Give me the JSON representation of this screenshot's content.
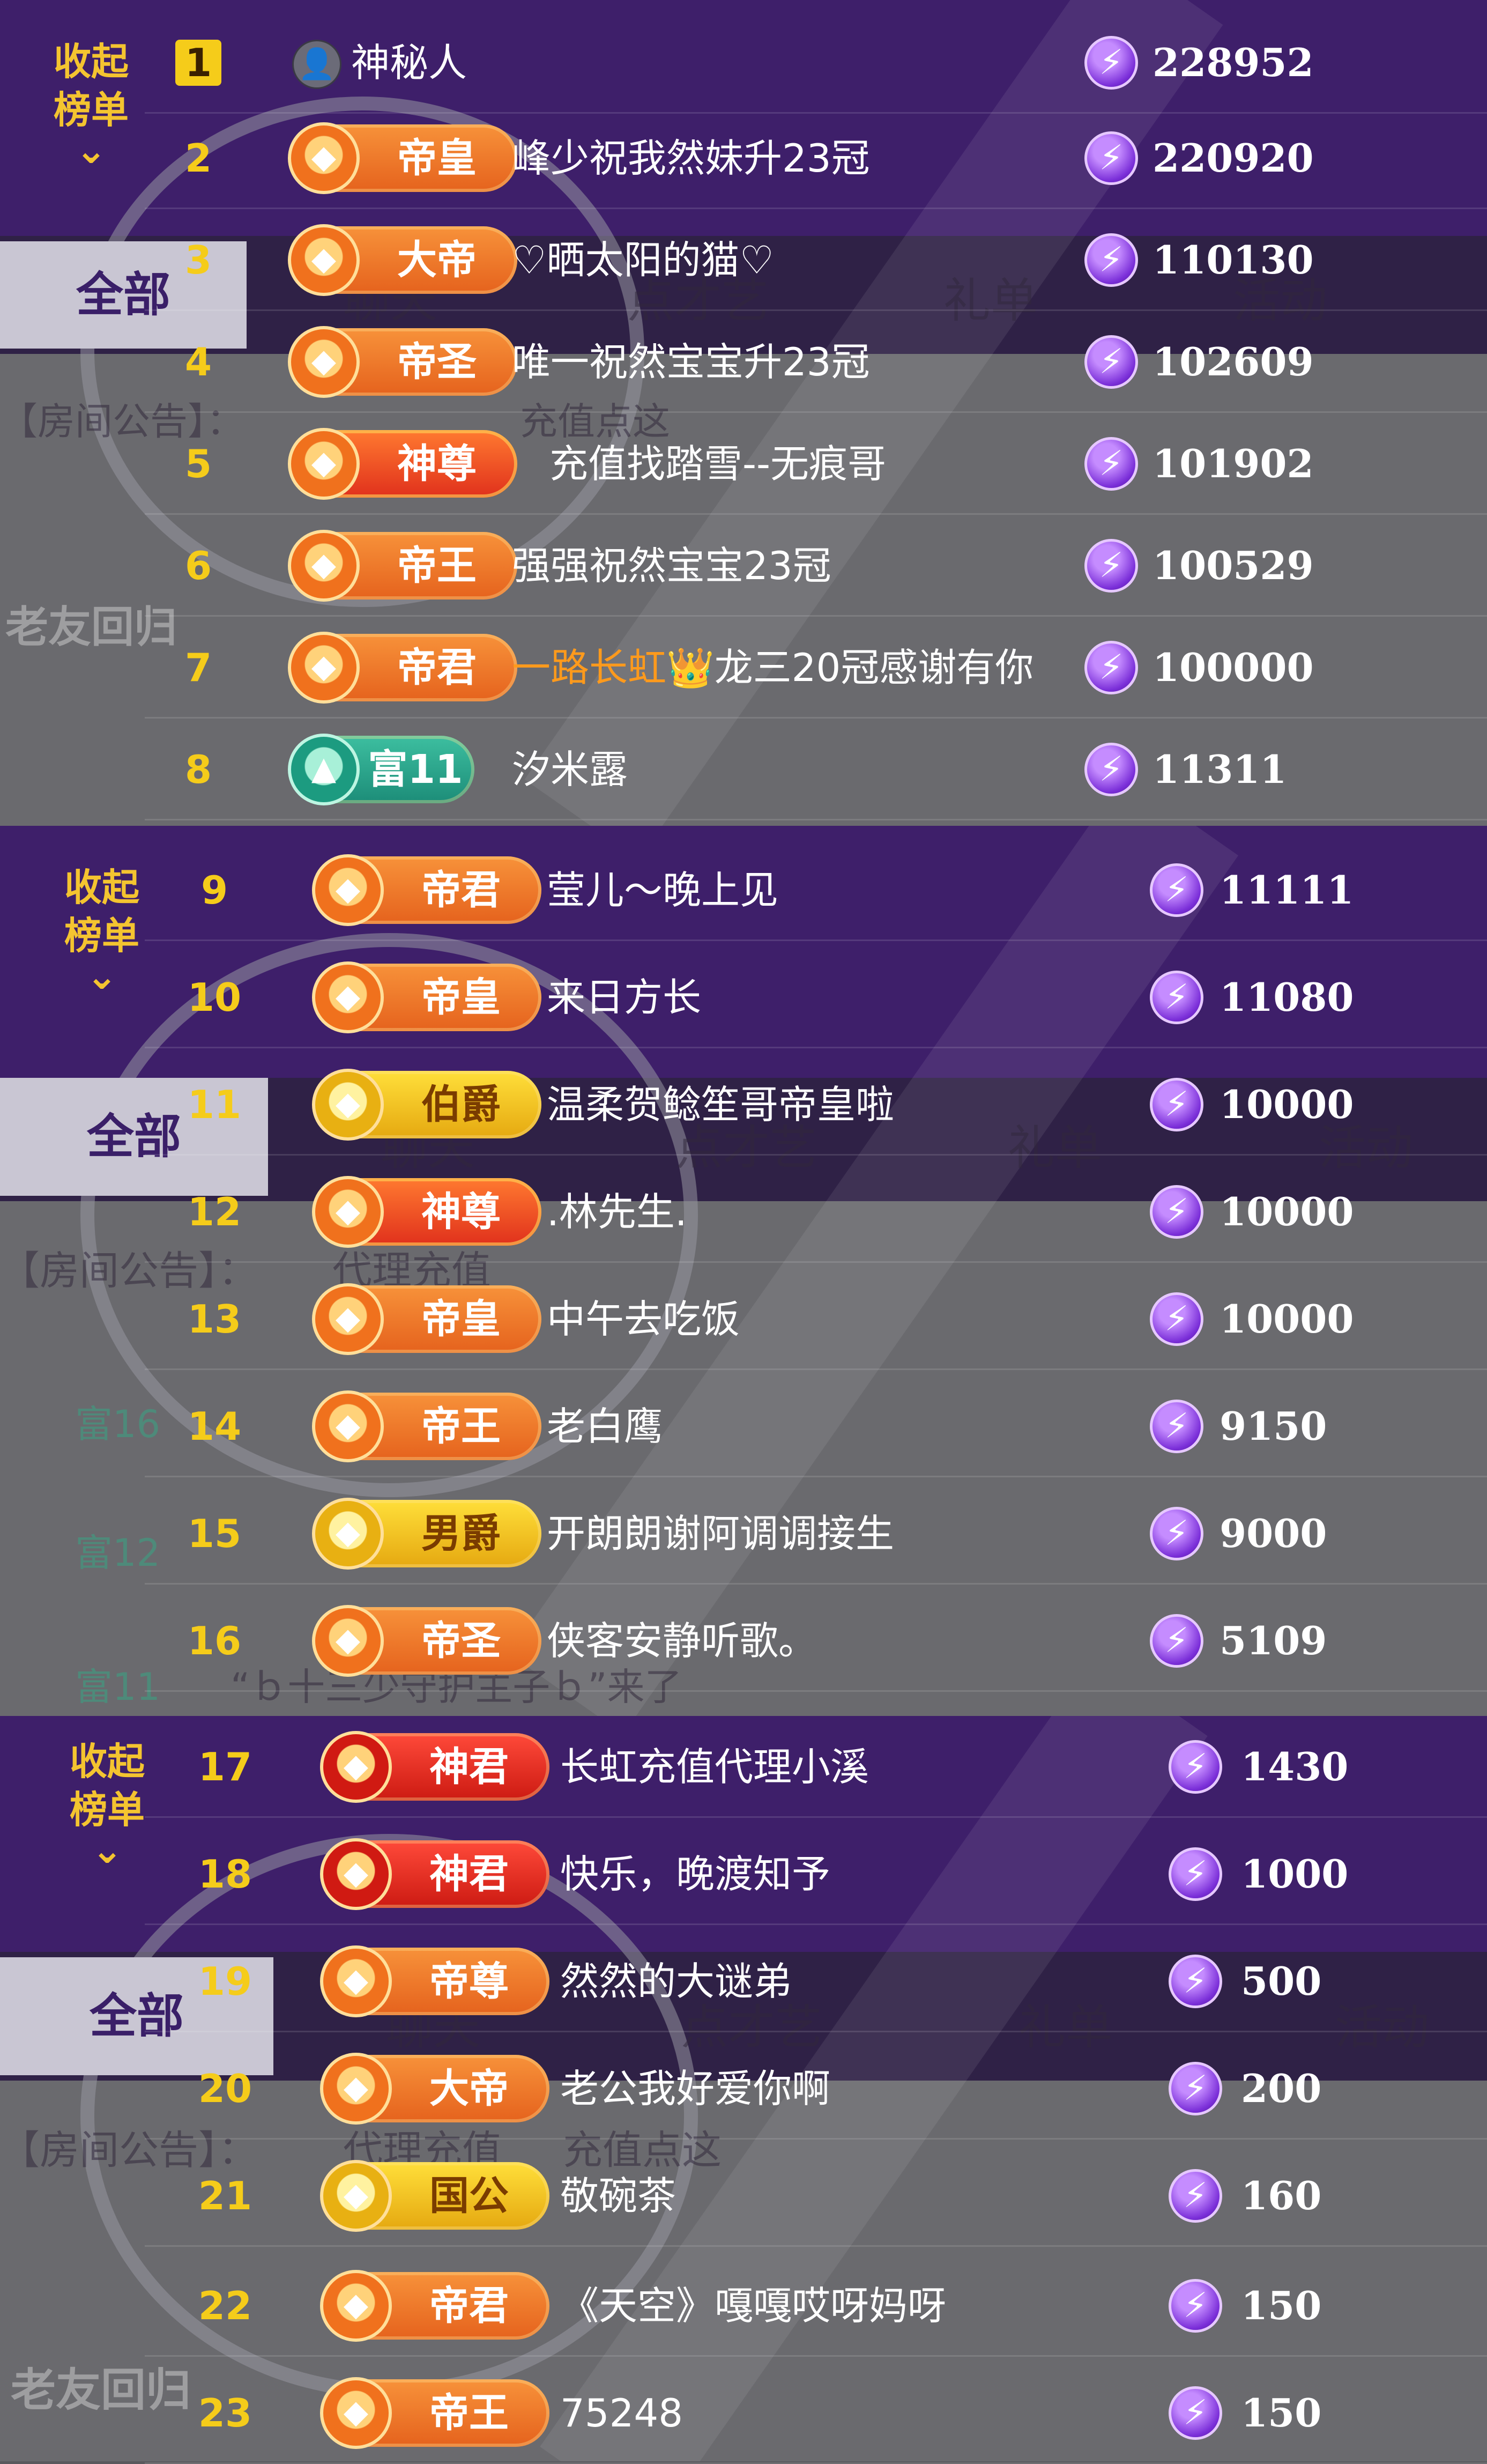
{
  "collapse_label": "收起\n榜单",
  "all_label": "全部",
  "bg_tabs": [
    "聊天",
    "点才艺",
    "礼单",
    "活动"
  ],
  "bg_notice": "【房间公告】：",
  "bg_agent": "代理充值",
  "bg_recharge": "充值点这",
  "bg_return": "老友回归",
  "bg_arrivals": [
    "富16",
    "富12",
    "富11"
  ],
  "bg_arrival_text": "“ｂ十三少守护主子ｂ”来了",
  "rows": [
    {
      "rank": "1",
      "badge": "",
      "name": "神秘人",
      "value": "228952"
    },
    {
      "rank": "2",
      "badge": "帝皇",
      "name": "峰少祝我然妹升23冠",
      "value": "220920"
    },
    {
      "rank": "3",
      "badge": "大帝",
      "name": "♡晒太阳的猫♡",
      "value": "110130"
    },
    {
      "rank": "4",
      "badge": "帝圣",
      "name": "唯一祝然宝宝升23冠",
      "value": "102609"
    },
    {
      "rank": "5",
      "badge": "神尊",
      "name": "充值找踏雪--无痕哥",
      "value": "101902"
    },
    {
      "rank": "6",
      "badge": "帝王",
      "name": "强强祝然宝宝23冠",
      "value": "100529"
    },
    {
      "rank": "7",
      "badge": "帝君",
      "name_orange": "一路长虹",
      "name": "龙三20冠感谢有你",
      "value": "100000"
    },
    {
      "rank": "8",
      "badge": "富11",
      "name": "汐米露",
      "value": "11311"
    },
    {
      "rank": "9",
      "badge": "帝君",
      "name": "莹儿～晚上见",
      "value": "11111"
    },
    {
      "rank": "10",
      "badge": "帝皇",
      "name": "来日方长",
      "value": "11080"
    },
    {
      "rank": "11",
      "badge": "伯爵",
      "name": "温柔贺鲶笙哥帝皇啦",
      "value": "10000"
    },
    {
      "rank": "12",
      "badge": "神尊",
      "name": ".林先生.",
      "value": "10000"
    },
    {
      "rank": "13",
      "badge": "帝皇",
      "name": "中午去吃饭",
      "value": "10000"
    },
    {
      "rank": "14",
      "badge": "帝王",
      "name": "老白鹰",
      "value": "9150"
    },
    {
      "rank": "15",
      "badge": "男爵",
      "name": "开朗朗谢阿调调接生",
      "value": "9000"
    },
    {
      "rank": "16",
      "badge": "帝圣",
      "name": "侠客安静听歌。",
      "value": "5109"
    },
    {
      "rank": "17",
      "badge": "神君",
      "name": "长虹充值代理小溪",
      "value": "1430"
    },
    {
      "rank": "18",
      "badge": "神君",
      "name": "快乐，晚渡知予",
      "value": "1000"
    },
    {
      "rank": "19",
      "badge": "帝尊",
      "name": "然然的大谜弟",
      "value": "500"
    },
    {
      "rank": "20",
      "badge": "大帝",
      "name": "老公我好爱你啊",
      "value": "200"
    },
    {
      "rank": "21",
      "badge": "国公",
      "name": "敬碗茶",
      "value": "160"
    },
    {
      "rank": "22",
      "badge": "帝君",
      "name": "《天空》嘎嘎哎呀妈呀",
      "value": "150"
    },
    {
      "rank": "23",
      "badge": "帝王",
      "name": "75248",
      "value": "150"
    }
  ]
}
